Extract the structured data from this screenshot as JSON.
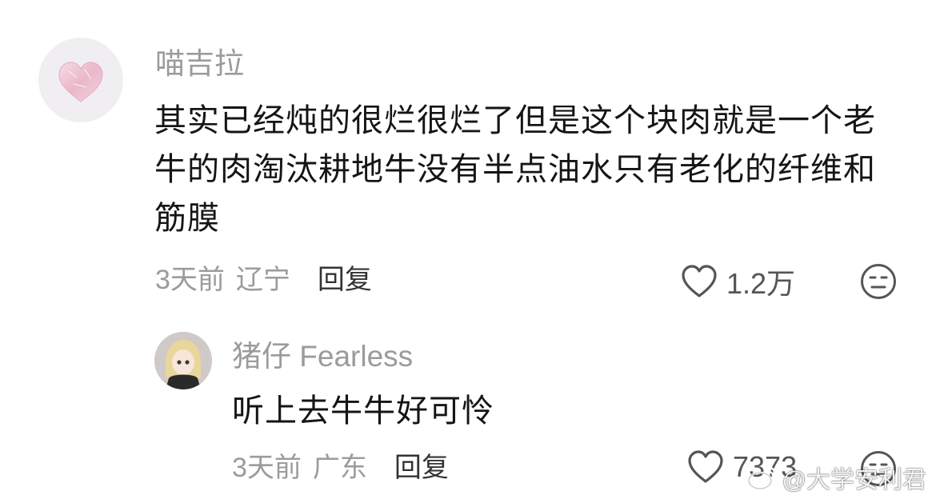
{
  "comments": [
    {
      "username": "喵吉拉",
      "text_lines": [
        "其实已经炖的很烂很烂了但是这个块肉就是一个老",
        "牛的肉淘汰耕地牛没有半点油水只有老化的纤维和",
        "筋膜"
      ],
      "time": "3天前",
      "location": "辽宁",
      "reply_label": "回复",
      "likes": "1.2万"
    },
    {
      "username": "猪仔 Fearless",
      "text_lines": [
        "听上去牛牛好可怜"
      ],
      "time": "3天前",
      "location": "广东",
      "reply_label": "回复",
      "likes": "7373"
    }
  ],
  "watermark": "@大学安利君",
  "colors": {
    "username": "#9b9b9b",
    "text": "#151515",
    "meta": "#9b9b9b",
    "reply": "#333333",
    "icon": "#555555"
  },
  "icons": {
    "like": "heart-outline-icon",
    "dislike": "meh-face-icon",
    "watermark": "weibo-logo-icon"
  }
}
